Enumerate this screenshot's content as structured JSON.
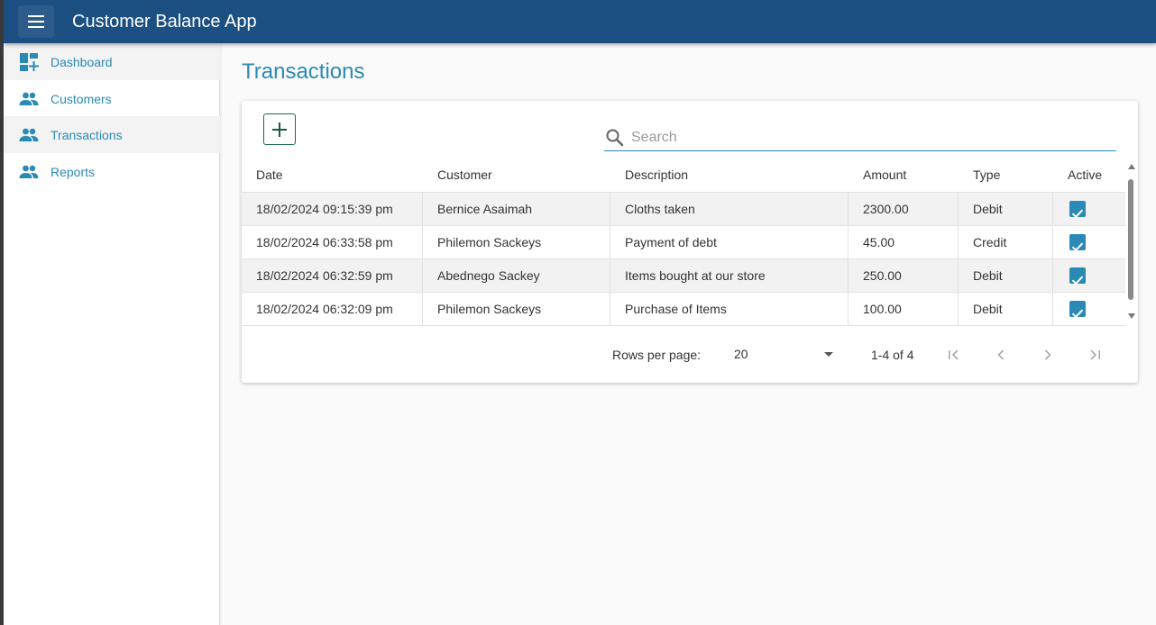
{
  "app": {
    "title": "Customer Balance App"
  },
  "icons": {
    "menu": "menu-icon",
    "dashboard": "dashboard-add-icon",
    "people": "people-icon",
    "search": "search-icon",
    "add": "plus-icon",
    "first": "first-page-icon",
    "prev": "chevron-left-icon",
    "next": "chevron-right-icon",
    "last": "last-page-icon"
  },
  "colors": {
    "topbar": "#1c4f82",
    "accent": "#2a8ab5",
    "add_button_border": "#1c6a4a"
  },
  "sidebar": {
    "items": [
      {
        "label": "Dashboard"
      },
      {
        "label": "Customers"
      },
      {
        "label": "Transactions"
      },
      {
        "label": "Reports"
      }
    ]
  },
  "page": {
    "title": "Transactions"
  },
  "search": {
    "placeholder": "Search",
    "value": ""
  },
  "table": {
    "columns": [
      "Date",
      "Customer",
      "Description",
      "Amount",
      "Type",
      "Active"
    ],
    "rows": [
      {
        "date": "18/02/2024 09:15:39 pm",
        "customer": "Bernice Asaimah",
        "description": "Cloths taken",
        "amount": "2300.00",
        "type": "Debit",
        "active": true
      },
      {
        "date": "18/02/2024 06:33:58 pm",
        "customer": "Philemon Sackeys",
        "description": "Payment of debt",
        "amount": "45.00",
        "type": "Credit",
        "active": true
      },
      {
        "date": "18/02/2024 06:32:59 pm",
        "customer": "Abednego Sackey",
        "description": "Items bought at our store",
        "amount": "250.00",
        "type": "Debit",
        "active": true
      },
      {
        "date": "18/02/2024 06:32:09 pm",
        "customer": "Philemon Sackeys",
        "description": "Purchase of Items",
        "amount": "100.00",
        "type": "Debit",
        "active": true
      }
    ]
  },
  "pagination": {
    "rows_per_page_label": "Rows per page:",
    "rows_per_page": "20",
    "range": "1-4 of 4"
  }
}
